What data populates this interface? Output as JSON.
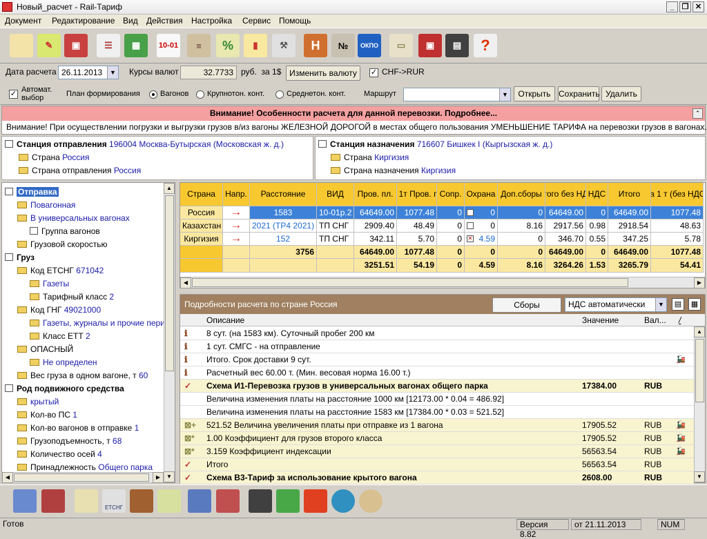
{
  "window": {
    "title": "Новый_расчет - Rail-Тариф"
  },
  "menu": [
    "Документ",
    "Редактирование",
    "Вид",
    "Действия",
    "Настройка",
    "Сервис",
    "Помощь"
  ],
  "toolbar_icons": [
    "new-document-icon",
    "open-icon",
    "save-icon",
    "print-preview-icon",
    "calculator-icon",
    "tariff-10-01-icon",
    "railway-icon",
    "percent-icon",
    "chart-icon",
    "tools-icon",
    "h-icon",
    "number-icon",
    "okpo-icon",
    "cargo-icon",
    "export-icon",
    "film-icon",
    "help-icon"
  ],
  "toolbar_tariff_label": "10-01",
  "toolbar_okpo_label": "ОКПО",
  "row2": {
    "date_label": "Дата расчета",
    "date_value": "26.11.2013",
    "rates_label": "Курсы валют",
    "rate_value": "32.7733",
    "rate_unit": "руб.  за 1$",
    "change_currency": "Изменить валюту",
    "chf_label": "CHF->RUR"
  },
  "row3": {
    "auto_label1": "Автомат.",
    "auto_label2": "выбор",
    "plan_label": "План формирования",
    "radio1": "Вагонов",
    "radio2": "Крупнотон. конт.",
    "radio3": "Среднетон. конт.",
    "route_label": "Маршрут",
    "route_value": "",
    "open": "Открыть",
    "save": "Сохранить",
    "delete": "Удалить"
  },
  "alert": {
    "title": "Внимание! Особенности расчета для данной перевозки. Подробнее...",
    "message": "Внимание! При осуществлении погрузки и выгрузки грузов в/из вагоны ЖЕЛЕЗНОЙ ДОРОГОЙ в местах общего пользования УМЕНЬШЕНИЕ ТАРИФА на перевозки грузов в вагонах..."
  },
  "departure": {
    "label": "Станция отправления",
    "value": "196004 Москва-Бутырская (Московская ж. д.)",
    "country_label": "Страна",
    "country": "Россия",
    "dep_country_label": "Страна отправления",
    "dep_country": "Россия"
  },
  "destination": {
    "label": "Станция назначения",
    "value": "716607 Бишкек I (Кыргызская ж. д.)",
    "country_label": "Страна",
    "country": "Киргизия",
    "dest_country_label": "Страна назначения",
    "dest_country": "Киргизия"
  },
  "tree": [
    {
      "t": "Отправка",
      "v": "",
      "lvl": 0,
      "icon": "doc",
      "bold": true,
      "sel": true
    },
    {
      "t": "Повагонная",
      "v": "",
      "lvl": 1,
      "icon": "folder",
      "blue": true
    },
    {
      "t": "В универсальных вагонах",
      "v": "",
      "lvl": 1,
      "icon": "folder",
      "blue": true
    },
    {
      "t": "Группа вагонов",
      "v": "",
      "lvl": 2,
      "icon": "box"
    },
    {
      "t": "Грузовой скоростью",
      "v": "",
      "lvl": 1,
      "icon": "folder"
    },
    {
      "t": "Груз",
      "v": "",
      "lvl": 0,
      "icon": "doc",
      "bold": true
    },
    {
      "t": "Код ЕТСНГ",
      "v": "671042",
      "lvl": 1,
      "icon": "folder"
    },
    {
      "t": "Газеты",
      "v": "",
      "lvl": 2,
      "icon": "folder",
      "blue": true
    },
    {
      "t": "Тарифный класс",
      "v": "2",
      "lvl": 2,
      "icon": "folder"
    },
    {
      "t": "Код ГНГ",
      "v": "49021000",
      "lvl": 1,
      "icon": "folder"
    },
    {
      "t": "Газеты, журналы и прочие пери",
      "v": "",
      "lvl": 2,
      "icon": "folder",
      "blue": true
    },
    {
      "t": "Класс ЕТТ",
      "v": "2",
      "lvl": 2,
      "icon": "folder"
    },
    {
      "t": "ОПАСНЫЙ",
      "v": "",
      "lvl": 1,
      "icon": "folder"
    },
    {
      "t": "Не определен",
      "v": "",
      "lvl": 2,
      "icon": "folder",
      "blue": true
    },
    {
      "t": "Вес груза в одном вагоне, т",
      "v": "60",
      "lvl": 1,
      "icon": "folder"
    },
    {
      "t": "Род подвижного средства",
      "v": "",
      "lvl": 0,
      "icon": "doc",
      "bold": true
    },
    {
      "t": "крытый",
      "v": "",
      "lvl": 1,
      "icon": "folder",
      "blue": true
    },
    {
      "t": "Кол-во ПС",
      "v": "1",
      "lvl": 1,
      "icon": "folder"
    },
    {
      "t": "Кол-во вагонов в отправке",
      "v": "1",
      "lvl": 1,
      "icon": "folder"
    },
    {
      "t": "Грузоподъемность, т",
      "v": "68",
      "lvl": 1,
      "icon": "folder"
    },
    {
      "t": "Количество осей",
      "v": "4",
      "lvl": 1,
      "icon": "folder"
    },
    {
      "t": "Принадлежность",
      "v": "Общего парка",
      "lvl": 1,
      "icon": "folder"
    }
  ],
  "grid": {
    "headers": [
      "Страна",
      "Напр.",
      "Расстояние",
      "ВИД",
      "Пров. пл.",
      "за 1т Пров. пл.",
      "Сопр.",
      "Охрана",
      "Доп.сборы",
      "Итого без НДС",
      "НДС",
      "Итого",
      "за 1 т (без НДС)"
    ],
    "rows": [
      [
        "Россия",
        "→",
        "1583",
        "10-01р.2",
        "64649.00",
        "1077.48",
        "0",
        "0",
        "0",
        "64649.00",
        "0",
        "64649.00",
        "1077.48"
      ],
      [
        "Казахстан",
        "→",
        "2021 (ТР4 2021)",
        "ТП СНГ",
        "2909.40",
        "48.49",
        "0",
        "0",
        "8.16",
        "2917.56",
        "0.98",
        "2918.54",
        "48.63"
      ],
      [
        "Киргизия",
        "→",
        "152",
        "ТП СНГ",
        "342.11",
        "5.70",
        "0",
        "4.59",
        "0",
        "346.70",
        "0.55",
        "347.25",
        "5.78"
      ]
    ],
    "total1": [
      "",
      "",
      "3756",
      "",
      "64649.00",
      "1077.48",
      "0",
      "0",
      "0",
      "64649.00",
      "0",
      "64649.00",
      "1077.48"
    ],
    "total2": [
      "",
      "",
      "",
      "",
      "3251.51",
      "54.19",
      "0",
      "4.59",
      "8.16",
      "3264.26",
      "1.53",
      "3265.79",
      "54.41"
    ]
  },
  "details": {
    "title": "Подробности расчета по стране Россия",
    "fees_button": "Сборы",
    "vat_select": "НДС автоматически",
    "headers": [
      "Описание",
      "Значение",
      "Вал..."
    ],
    "rows": [
      {
        "desc": "8 сут. (на 1583 км). Суточный пробег 200 км",
        "val": "",
        "cur": "",
        "icon": "info",
        "bold": false,
        "hl": false,
        "train": false
      },
      {
        "desc": "1 сут. СМГС - на отправление",
        "val": "",
        "cur": "",
        "icon": "info",
        "bold": false,
        "hl": false,
        "train": false
      },
      {
        "desc": "Итого. Срок доставки 9 сут.",
        "val": "",
        "cur": "",
        "icon": "info",
        "bold": false,
        "hl": false,
        "train": true
      },
      {
        "desc": "Расчетный вес 60.00 т. (Мин. весовая норма 16.00 т.)",
        "val": "",
        "cur": "",
        "icon": "info",
        "bold": false,
        "hl": false,
        "train": false
      },
      {
        "desc": "Схема И1-Перевозка грузов в универсальных вагонах общего парка",
        "val": "17384.00",
        "cur": "RUB",
        "icon": "check",
        "bold": true,
        "hl": true,
        "train": false
      },
      {
        "desc": "Величина изменения платы на расстояние 1000 км [12173.00 * 0.04 = 486.92]",
        "val": "",
        "cur": "",
        "icon": "",
        "bold": false,
        "hl": false,
        "train": false
      },
      {
        "desc": "Величина изменения платы на расстояние 1583 км [17384.00 * 0.03 = 521.52]",
        "val": "",
        "cur": "",
        "icon": "",
        "bold": false,
        "hl": false,
        "train": false
      },
      {
        "desc": "521.52 Величина увеличения платы при отправке из 1 вагона",
        "val": "17905.52",
        "cur": "RUB",
        "icon": "plus",
        "bold": false,
        "hl": true,
        "train": true
      },
      {
        "desc": "1.00 Коэффициент для грузов второго класса",
        "val": "17905.52",
        "cur": "RUB",
        "icon": "star",
        "bold": false,
        "hl": true,
        "train": true
      },
      {
        "desc": "3.159 Коэффициент индексации",
        "val": "56563.54",
        "cur": "RUB",
        "icon": "star",
        "bold": false,
        "hl": true,
        "train": true
      },
      {
        "desc": "Итого",
        "val": "56563.54",
        "cur": "RUB",
        "icon": "check",
        "bold": false,
        "hl": true,
        "train": false
      },
      {
        "desc": "Схема В3-Тариф за использование крытого вагона",
        "val": "2608.00",
        "cur": "RUB",
        "icon": "check",
        "bold": true,
        "hl": true,
        "train": false
      }
    ]
  },
  "bottom_icons": [
    "loco-station-icon",
    "wagons-icon",
    "mail-icon",
    "etsng-mail-icon",
    "wagon-icon",
    "mail-check-icon",
    "station-train-icon",
    "station2-icon",
    "steam-loco-icon",
    "rail-map-icon",
    "russia-map-icon",
    "globe-search-icon",
    "seal-icon"
  ],
  "bottom_etsng_label": "ЕТСНГ",
  "status": {
    "ready": "Готов",
    "version": "Версия 8.82",
    "date": "от 21.11.2013",
    "num": "NUM"
  }
}
